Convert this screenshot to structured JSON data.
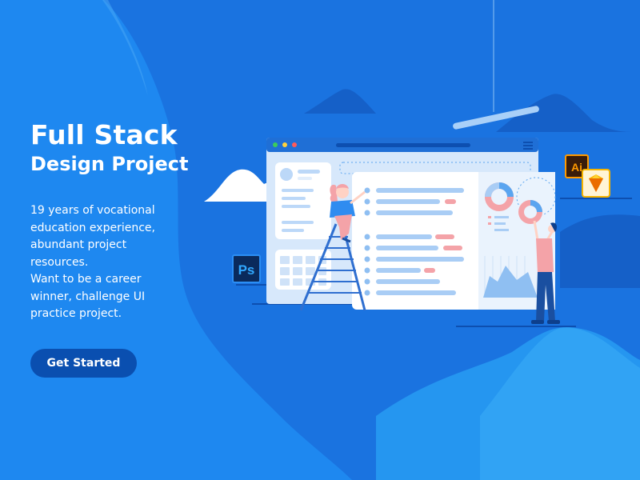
{
  "hero": {
    "title": "Full Stack",
    "subtitle": "Design Project",
    "description_lines": [
      "19 years of vocational education experience, abundant project resources.",
      "Want to be a career winner, challenge UI practice project."
    ],
    "cta_label": "Get Started"
  },
  "illustration": {
    "app_icons": [
      {
        "name": "photoshop-icon",
        "label": "Ps"
      },
      {
        "name": "illustrator-icon",
        "label": "Ai"
      },
      {
        "name": "sketch-icon",
        "label": ""
      }
    ],
    "browser_dots": [
      "#ff5a5a",
      "#ffd23c",
      "#3ccc5a"
    ]
  },
  "colors": {
    "background": "#1a73e0",
    "left_panel": "#1e88f0",
    "accent_button": "#0a4fb0",
    "pink": "#f4a3a8",
    "light_blue": "#a9cdf5"
  }
}
